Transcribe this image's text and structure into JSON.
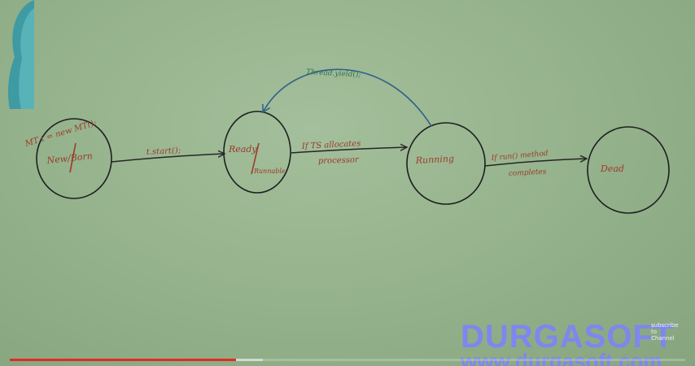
{
  "diagram": {
    "states": [
      {
        "id": "new",
        "label": "New/Born"
      },
      {
        "id": "ready",
        "label_top": "Ready",
        "label_bottom": "Runnable"
      },
      {
        "id": "running",
        "label": "Running"
      },
      {
        "id": "dead",
        "label": "Dead"
      }
    ],
    "annotation_new": "MT t = new MT();",
    "transitions": {
      "start": "t.start();",
      "ts_line1": "If TS allocates",
      "ts_line2": "processor",
      "run_line1": "If run() method",
      "run_line2": "completes",
      "yield": "Thread.yield();"
    }
  },
  "branding": {
    "name": "DURGASOFT",
    "url": "www.durgasoft.com",
    "subscribe_line1": "subscribe",
    "subscribe_line2": "to",
    "subscribe_line3": "Channel"
  },
  "video": {
    "progress": 0.335,
    "buffered": 0.375
  },
  "colors": {
    "chalk_red": "#9c3a2a",
    "chalk_blue": "#2f5f86",
    "chalk_green": "#2f6e54",
    "brand": "#7f86ee",
    "progress": "#e12b22"
  }
}
